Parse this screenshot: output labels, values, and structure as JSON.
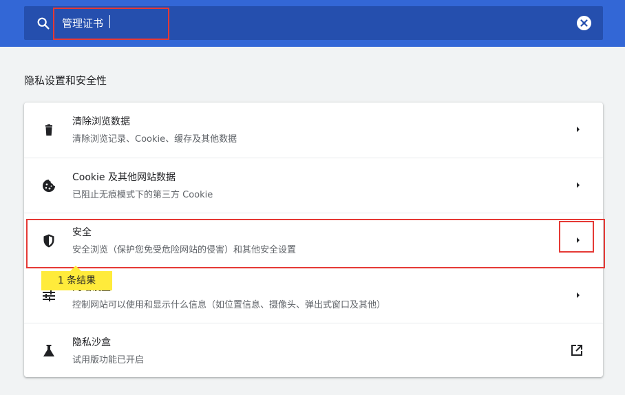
{
  "search": {
    "value": "管理证书"
  },
  "section": {
    "title": "隐私设置和安全性"
  },
  "rows": [
    {
      "title": "清除浏览数据",
      "subtitle": "清除浏览记录、Cookie、缓存及其他数据",
      "icon": "trash-icon"
    },
    {
      "title": "Cookie 及其他网站数据",
      "subtitle": "已阻止无痕模式下的第三方 Cookie",
      "icon": "cookie-icon"
    },
    {
      "title": "安全",
      "subtitle": "安全浏览（保护您免受危险网站的侵害）和其他安全设置",
      "icon": "shield-icon"
    },
    {
      "title": "网站设置",
      "subtitle": "控制网站可以使用和显示什么信息（如位置信息、摄像头、弹出式窗口及其他）",
      "icon": "tune-icon"
    },
    {
      "title": "隐私沙盒",
      "subtitle": "试用版功能已开启",
      "icon": "flask-icon"
    }
  ],
  "search_result_bubble": "1 条结果",
  "colors": {
    "header_blue": "#3367d6",
    "search_bg": "#254fae",
    "highlight_red": "#e53935",
    "bubble_yellow": "#ffeb3b"
  }
}
